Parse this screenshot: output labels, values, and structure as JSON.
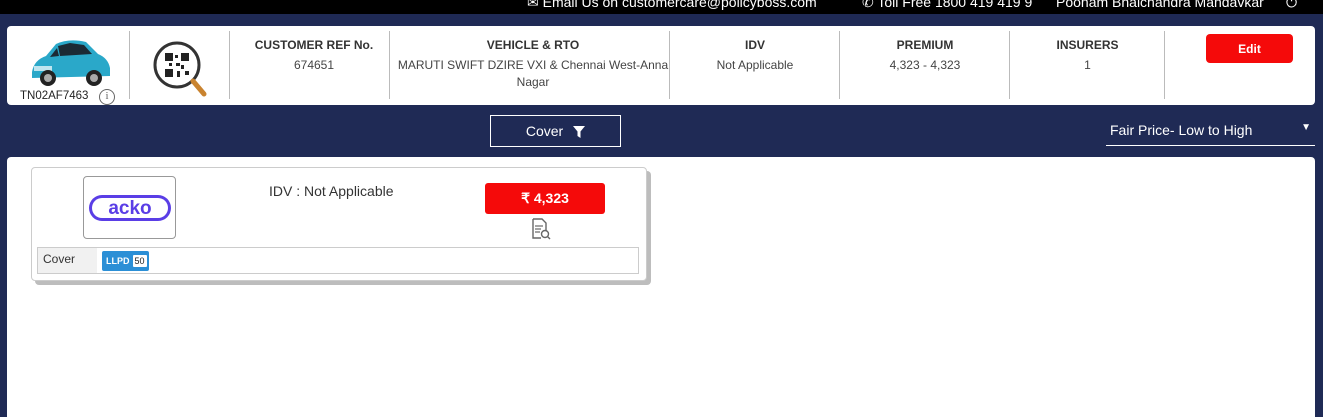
{
  "topbar": {
    "email": "Email Us on customercare@policyboss.com",
    "tollfree": "Toll Free 1800 419 419 9",
    "user": "Poonam Bhalchandra Mandavkar"
  },
  "summary": {
    "registration": "TN02AF7463",
    "customer_ref_label": "CUSTOMER REF No.",
    "customer_ref_value": "674651",
    "vehicle_label": "VEHICLE & RTO",
    "vehicle_value": "MARUTI SWIFT DZIRE VXI & Chennai West-Anna Nagar",
    "idv_label": "IDV",
    "idv_value": "Not Applicable",
    "premium_label": "PREMIUM",
    "premium_value": "4,323 - 4,323",
    "insurers_label": "INSURERS",
    "insurers_value": "1",
    "edit_label": "Edit"
  },
  "filters": {
    "cover_label": "Cover",
    "sort_label": "Fair Price- Low to High"
  },
  "quotes": [
    {
      "insurer_logo_text": "acko",
      "idv_text": "IDV : Not Applicable",
      "price": "₹ 4,323",
      "cover_label": "Cover",
      "cover_code": "LLPD",
      "cover_amount": "50"
    }
  ],
  "colors": {
    "navy": "#1f2a55",
    "accent_red": "#f50a0a",
    "badge_blue": "#2b8fd6",
    "acko_purple": "#5a3ee6"
  }
}
